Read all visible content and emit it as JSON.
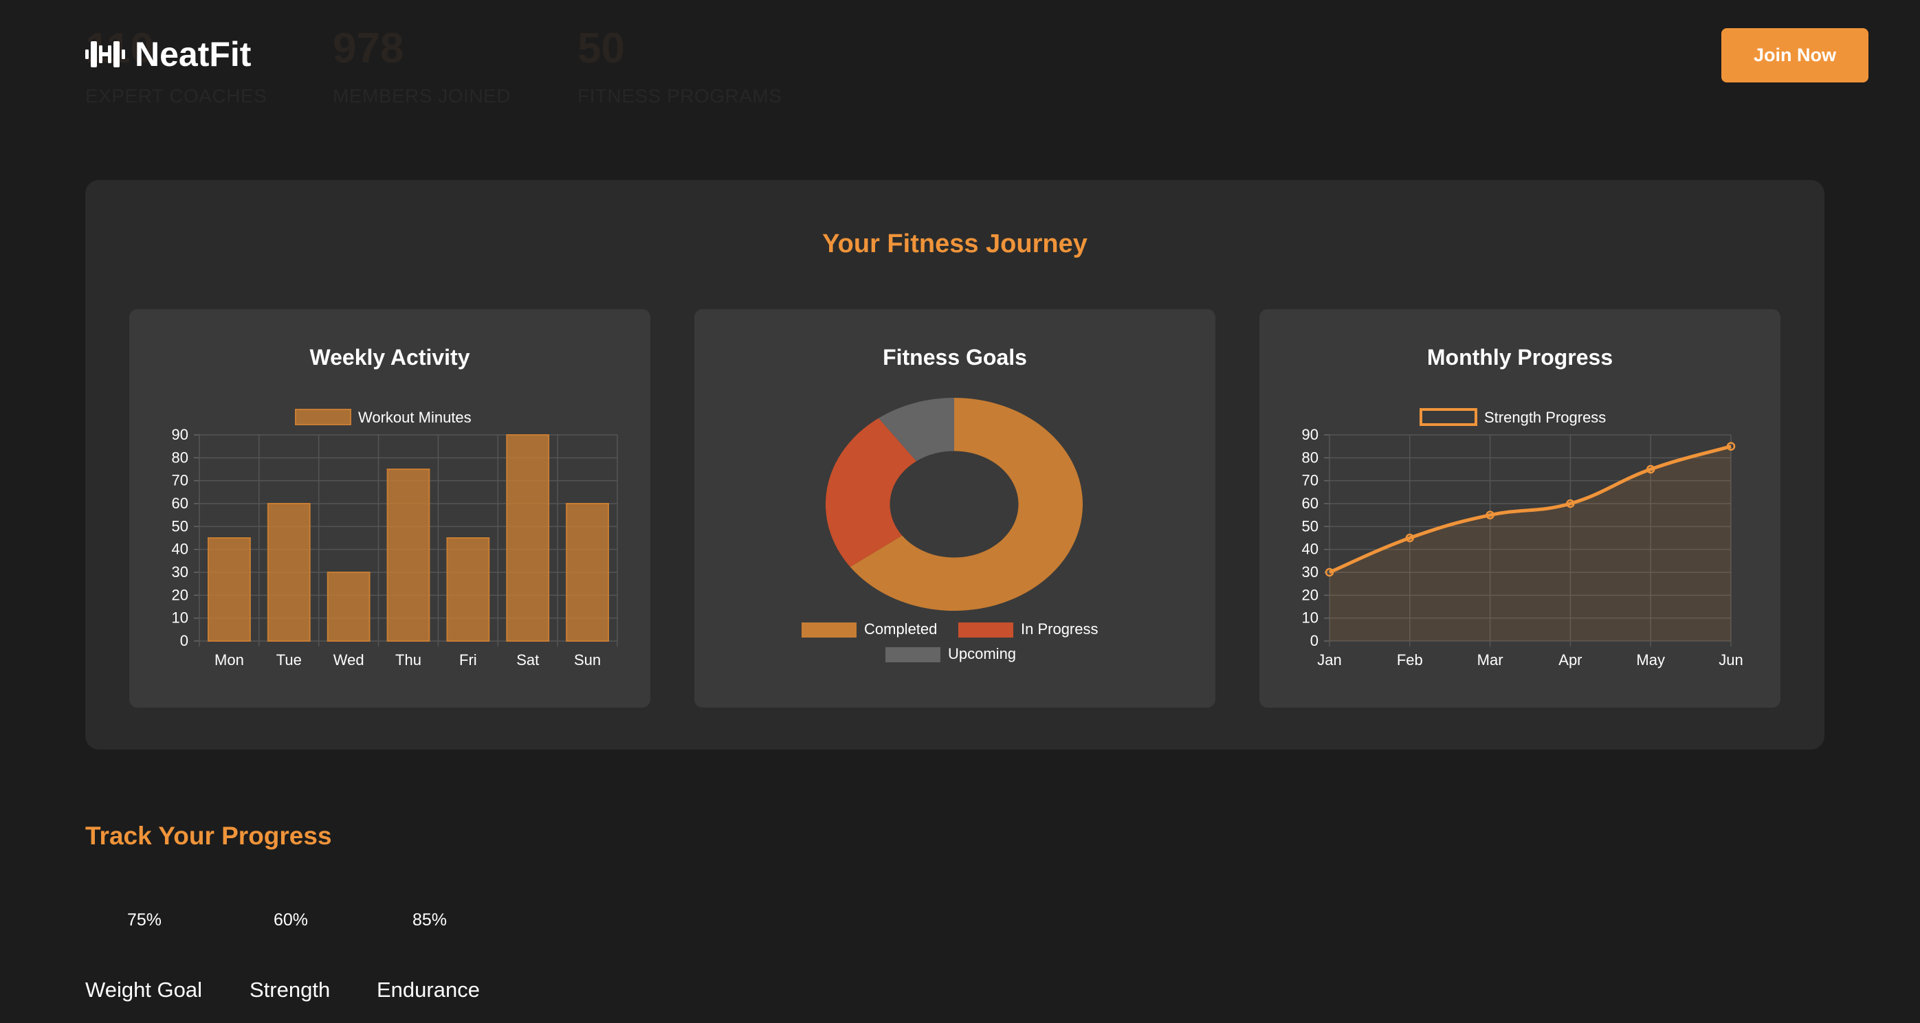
{
  "brand": {
    "name": "NeatFit",
    "logo_icon": "dumbbell-icon",
    "accent": "#f0943a"
  },
  "header": {
    "join_label": "Join Now"
  },
  "stats": [
    {
      "value": "110",
      "label": "EXPERT COACHES"
    },
    {
      "value": "978",
      "label": "MEMBERS JOINED"
    },
    {
      "value": "50",
      "label": "FITNESS PROGRAMS"
    }
  ],
  "journey": {
    "title": "Your Fitness Journey"
  },
  "charts": {
    "weekly": {
      "title": "Weekly Activity"
    },
    "goals": {
      "title": "Fitness Goals"
    },
    "monthly": {
      "title": "Monthly Progress"
    }
  },
  "chart_data": [
    {
      "type": "bar",
      "title": "Weekly Activity",
      "categories": [
        "Mon",
        "Tue",
        "Wed",
        "Thu",
        "Fri",
        "Sat",
        "Sun"
      ],
      "series": [
        {
          "name": "Workout Minutes",
          "values": [
            45,
            60,
            30,
            75,
            45,
            90,
            60
          ]
        }
      ],
      "ylim": [
        0,
        90
      ],
      "yticks": [
        0,
        10,
        20,
        30,
        40,
        50,
        60,
        70,
        80,
        90
      ],
      "grid": true,
      "legend": "top",
      "color": "#c77d33"
    },
    {
      "type": "pie",
      "title": "Fitness Goals",
      "categories": [
        "Completed",
        "In Progress",
        "Upcoming"
      ],
      "values": [
        65,
        25,
        10
      ],
      "colors": [
        "#c77d33",
        "#c8502c",
        "#656565"
      ],
      "legend": "bottom"
    },
    {
      "type": "area",
      "title": "Monthly Progress",
      "categories": [
        "Jan",
        "Feb",
        "Mar",
        "Apr",
        "May",
        "Jun"
      ],
      "series": [
        {
          "name": "Strength Progress",
          "values": [
            30,
            45,
            55,
            60,
            75,
            85
          ]
        }
      ],
      "ylim": [
        0,
        90
      ],
      "yticks": [
        0,
        10,
        20,
        30,
        40,
        50,
        60,
        70,
        80,
        90
      ],
      "grid": true,
      "legend": "top",
      "color": "#f0943a"
    }
  ],
  "track": {
    "title": "Track Your Progress",
    "items": [
      {
        "percent": "75%",
        "label": "Weight Goal"
      },
      {
        "percent": "60%",
        "label": "Strength"
      },
      {
        "percent": "85%",
        "label": "Endurance"
      }
    ]
  }
}
